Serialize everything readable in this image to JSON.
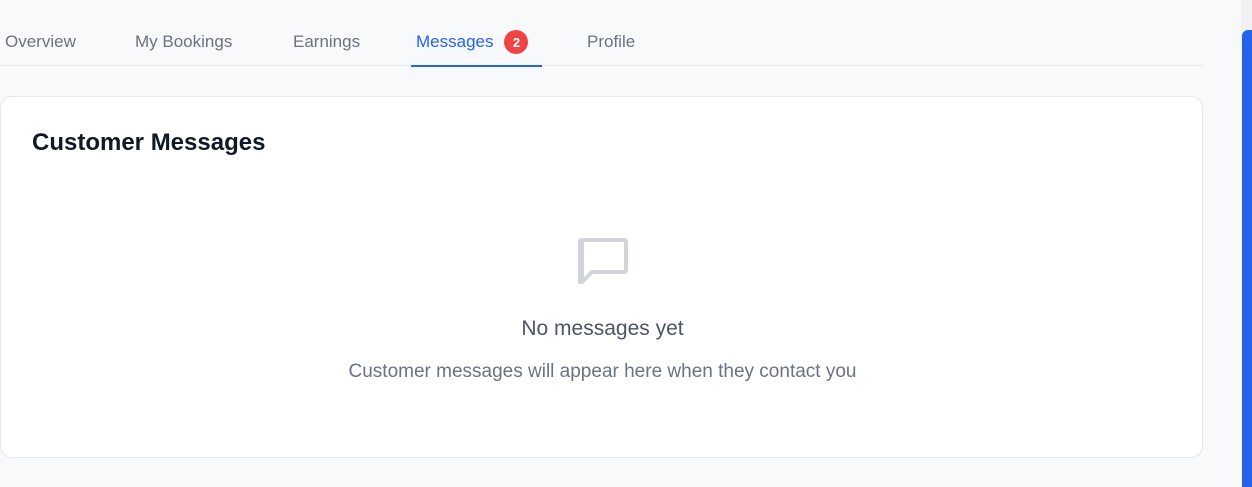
{
  "tabs": [
    {
      "label": "Overview",
      "active": false
    },
    {
      "label": "My Bookings",
      "active": false
    },
    {
      "label": "Earnings",
      "active": false
    },
    {
      "label": "Messages",
      "active": true,
      "badge": "2"
    },
    {
      "label": "Profile",
      "active": false
    }
  ],
  "card": {
    "title": "Customer Messages",
    "empty_state": {
      "icon": "message-square-icon",
      "title": "No messages yet",
      "subtitle": "Customer messages will appear here when they contact you"
    }
  },
  "colors": {
    "accent": "#2563eb",
    "badge": "#ef4444",
    "page_background": "#f8f9fb"
  }
}
